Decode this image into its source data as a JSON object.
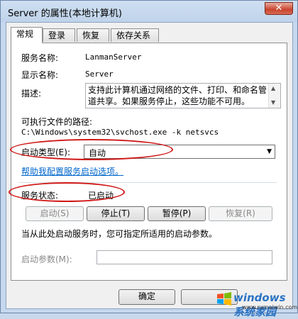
{
  "window": {
    "title": "Server 的属性(本地计算机)",
    "close_label": "✕"
  },
  "tabs": [
    {
      "label": "常规",
      "active": true
    },
    {
      "label": "登录",
      "active": false
    },
    {
      "label": "恢复",
      "active": false
    },
    {
      "label": "依存关系",
      "active": false
    }
  ],
  "general": {
    "service_name_label": "服务名称:",
    "service_name_value": "LanmanServer",
    "display_name_label": "显示名称:",
    "display_name_value": "Server",
    "description_label": "描述:",
    "description_value": "支持此计算机通过网络的文件、打印、和命名管道共享。如果服务停止，这些功能不可用。",
    "exe_path_label": "可执行文件的路径:",
    "exe_path_value": "C:\\Windows\\system32\\svchost.exe -k netsvcs",
    "startup_type_label": "启动类型(E):",
    "startup_type_value": "自动",
    "help_link": "帮助我配置服务启动选项。",
    "service_status_label": "服务状态:",
    "service_status_value": "已启动",
    "btn_start": "启动(S)",
    "btn_stop": "停止(T)",
    "btn_pause": "暂停(P)",
    "btn_resume": "恢复(R)",
    "hint_text": "当从此处启动服务时，您可指定所适用的启动参数。",
    "start_params_label": "启动参数(M):",
    "start_params_value": ""
  },
  "footer": {
    "ok_label": "确定"
  },
  "watermark": {
    "title": "windows系统家园",
    "url": "www.rumaiwin.com"
  },
  "colors": {
    "annotation_ellipse": "#d01818",
    "link": "#0066cc"
  }
}
